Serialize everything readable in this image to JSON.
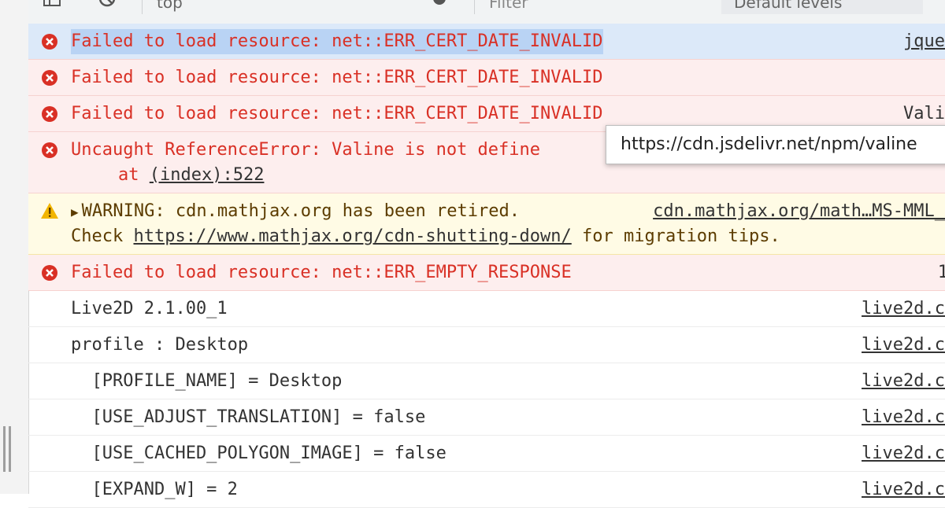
{
  "toolbar": {
    "context": "top",
    "filter_placeholder": "Filter",
    "levels": "Default levels"
  },
  "rows": [
    {
      "type": "error",
      "message": "Failed to load resource: net::ERR_CERT_DATE_INVALID",
      "source": "jque"
    },
    {
      "type": "error",
      "message": "Failed to load resource: net::ERR_CERT_DATE_INVALID",
      "source": ""
    },
    {
      "type": "error",
      "message": "Failed to load resource: net::ERR_CERT_DATE_INVALID",
      "source": "Vali"
    },
    {
      "type": "error",
      "message": "Uncaught ReferenceError: Valine is not define",
      "line2_prefix": "at ",
      "line2_link": "(index):522"
    },
    {
      "type": "warning",
      "message": "WARNING: cdn.mathjax.org has been retired.",
      "source": "cdn.mathjax.org/math…MS-MML_",
      "line2_prefix": "Check ",
      "line2_link": "https://www.mathjax.org/cdn-shutting-down/",
      "line2_suffix": " for migration tips."
    },
    {
      "type": "error",
      "message": "Failed to load resource: net::ERR_EMPTY_RESPONSE",
      "source": "1"
    },
    {
      "type": "log",
      "message": "Live2D 2.1.00_1",
      "source": "live2d.c"
    },
    {
      "type": "log",
      "message": "profile : Desktop",
      "source": "live2d.c"
    },
    {
      "type": "log",
      "message": "  [PROFILE_NAME] = Desktop",
      "source": "live2d.c"
    },
    {
      "type": "log",
      "message": "  [USE_ADJUST_TRANSLATION] = false",
      "source": "live2d.c"
    },
    {
      "type": "log",
      "message": "  [USE_CACHED_POLYGON_IMAGE] = false",
      "source": "live2d.c"
    },
    {
      "type": "log",
      "message": "  [EXPAND_W] = 2",
      "source": "live2d.c"
    }
  ],
  "tooltip": {
    "text": "https://cdn.jsdelivr.net/npm/valine"
  },
  "colors": {
    "error_text": "#d93025",
    "error_bg": "#fdeeee",
    "selected_bg": "#dce9f9",
    "warning_bg": "#fffbe5",
    "warning_icon": "#f2b500"
  }
}
